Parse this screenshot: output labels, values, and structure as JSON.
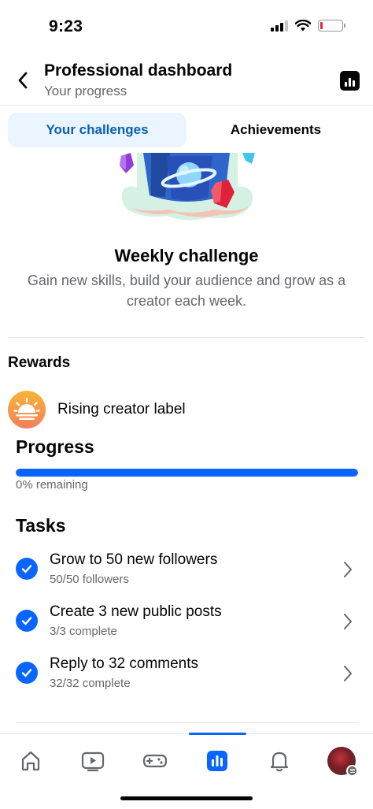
{
  "status_bar": {
    "time": "9:23"
  },
  "header": {
    "title": "Professional dashboard",
    "subtitle": "Your progress"
  },
  "tabs": [
    {
      "label": "Your challenges",
      "active": true
    },
    {
      "label": "Achievements",
      "active": false
    }
  ],
  "challenge": {
    "title": "Weekly challenge",
    "description": "Gain new skills, build your audience and grow as a creator each week."
  },
  "rewards": {
    "heading": "Rewards",
    "items": [
      {
        "label": "Rising creator label",
        "icon": "sunrise-icon"
      }
    ]
  },
  "progress": {
    "heading": "Progress",
    "remaining_text": "0% remaining",
    "fraction_complete": 1.0
  },
  "tasks": {
    "heading": "Tasks",
    "items": [
      {
        "title": "Grow to 50 new followers",
        "status": "50/50 followers",
        "done": true
      },
      {
        "title": "Create 3 new public posts",
        "status": "3/3 complete",
        "done": true
      },
      {
        "title": "Reply to 32 comments",
        "status": "32/32 complete",
        "done": true
      }
    ]
  },
  "bottom_nav": {
    "items": [
      "home-icon",
      "video-icon",
      "gaming-icon",
      "dashboard-icon",
      "notifications-icon",
      "profile-avatar"
    ],
    "active": "dashboard-icon"
  },
  "colors": {
    "accent": "#0866ff",
    "tab_active_bg": "#ebf5ff",
    "tab_active_text": "#0a5fb4",
    "secondary_text": "#65676b"
  }
}
